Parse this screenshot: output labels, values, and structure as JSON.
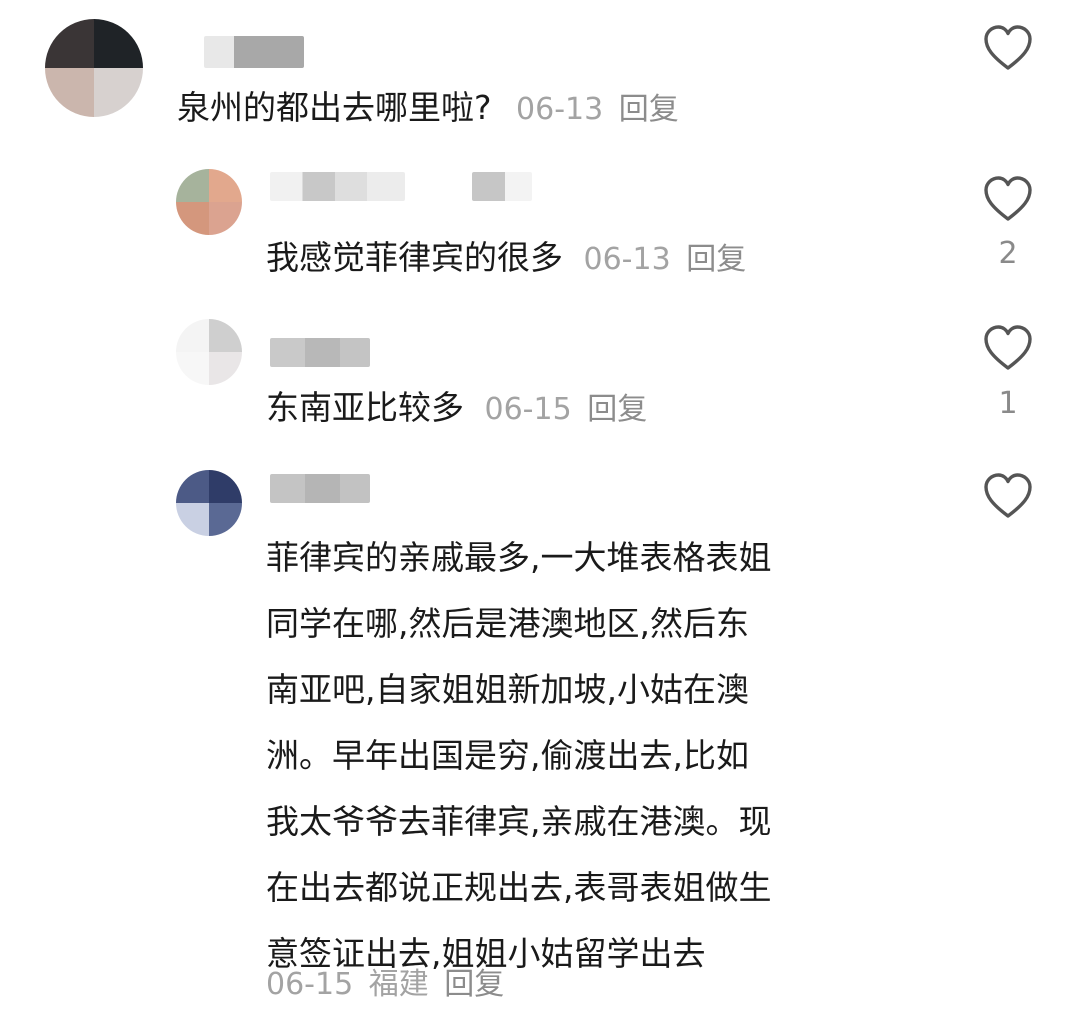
{
  "comment": {
    "text": "泉州的都出去哪里啦?",
    "date": "06-13",
    "reply_label": "回复"
  },
  "replies": [
    {
      "text": "我感觉菲律宾的很多",
      "date": "06-13",
      "reply_label": "回复",
      "like_count": "2"
    },
    {
      "text": "东南亚比较多",
      "date": "06-15",
      "reply_label": "回复",
      "like_count": "1"
    },
    {
      "text_lines": [
        "菲律宾的亲戚最多,一大堆表格表姐",
        "同学在哪,然后是港澳地区,然后东",
        "南亚吧,自家姐姐新加坡,小姑在澳",
        "洲。早年出国是穷,偷渡出去,比如",
        "我太爷爷去菲律宾,亲戚在港澳。现",
        "在出去都说正规出去,表哥表姐做生",
        "意签证出去,姐姐小姑留学出去"
      ],
      "date": "06-15",
      "location": "福建",
      "reply_label": "回复"
    }
  ],
  "icons": {
    "like": "heart-outline-icon"
  },
  "colors": {
    "meta_gray": "#a3a3a3",
    "text": "#1a1a1a"
  }
}
